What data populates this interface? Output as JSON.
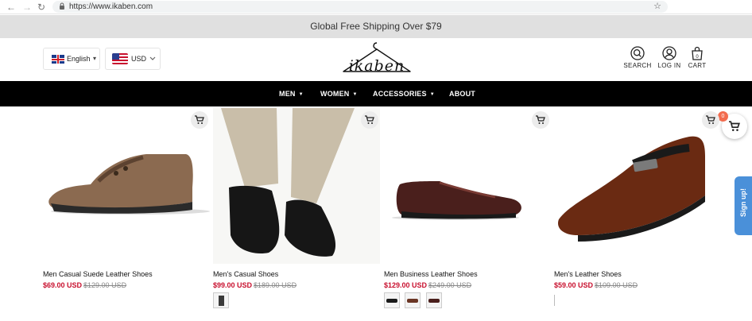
{
  "browser": {
    "url": "https://www.ikaben.com",
    "back": "←",
    "forward": "→",
    "reload": "↻",
    "lock": "🔒",
    "star": "☆"
  },
  "announcement": "Global Free Shipping Over $79",
  "header": {
    "language": {
      "label": "English",
      "flag": "uk-flag-icon"
    },
    "currency": {
      "label": "USD",
      "flag": "us-flag-icon"
    },
    "logo_text": "ikaben",
    "icons": {
      "search": "SEARCH",
      "login": "LOG IN",
      "cart": "CART",
      "cart_count": "0"
    }
  },
  "menu": {
    "items": [
      {
        "label": "MEN",
        "has_dropdown": true
      },
      {
        "label": "WOMEN",
        "has_dropdown": true
      },
      {
        "label": "ACCESSORIES",
        "has_dropdown": true
      },
      {
        "label": "ABOUT",
        "has_dropdown": false
      }
    ],
    "dropdown_glyph": "▼"
  },
  "products": [
    {
      "title": "Men Casual Suede Leather Shoes",
      "price": "$69.00 USD",
      "compare_price": "$129.00 USD",
      "swatches": 0,
      "color": "#8b6a50"
    },
    {
      "title": "Men's Casual Shoes",
      "price": "$99.00 USD",
      "compare_price": "$189.00 USD",
      "swatches": 1,
      "color": "#151515"
    },
    {
      "title": "Men Business Leather Shoes",
      "price": "$129.00 USD",
      "compare_price": "$249.00 USD",
      "swatches": 3,
      "color": "#4a1f1c"
    },
    {
      "title": "Men's Leather Shoes",
      "price": "$59.00 USD",
      "compare_price": "$109.00 USD",
      "swatches": 0,
      "color": "#6a2a12"
    }
  ],
  "floating_cart": {
    "count": "0"
  },
  "signup_tab": "Sign up!",
  "colors": {
    "sale_price": "#c8102e",
    "menu_bg": "#000000",
    "announce_bg": "#e0e0e0",
    "signup_bg": "#4a90d9",
    "badge": "#f26b4e"
  }
}
